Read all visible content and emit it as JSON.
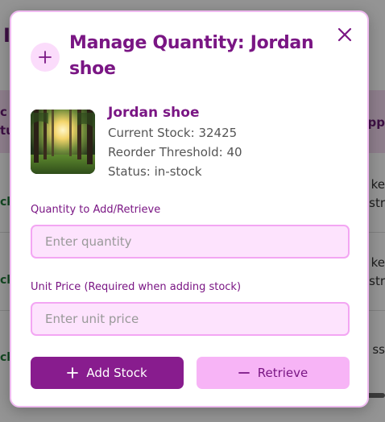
{
  "modal": {
    "title": "Manage Quantity: Jordan shoe",
    "product": {
      "name": "Jordan shoe",
      "current_stock": "Current Stock: 32425",
      "reorder_threshold": "Reorder Threshold: 40",
      "status": "Status: in-stock"
    },
    "quantity_field": {
      "label": "Quantity to Add/Retrieve",
      "placeholder": "Enter quantity",
      "value": ""
    },
    "price_field": {
      "label": "Unit Price (Required when adding stock)",
      "placeholder": "Enter unit price",
      "value": ""
    },
    "add_button_label": "Add Stock",
    "retrieve_button_label": "Retrieve"
  },
  "background": {
    "title_fragment": "I",
    "left_header": [
      "c",
      "tu"
    ],
    "right_header": "upp",
    "rows": [
      {
        "left": "ck",
        "right": [
          "ke",
          "str"
        ]
      },
      {
        "left": "ck",
        "right": [
          "ke",
          "str"
        ]
      },
      {
        "left": "ck",
        "right": [
          "ss"
        ]
      }
    ]
  },
  "colors": {
    "accent": "#7a1684",
    "button_primary": "#881c8e",
    "button_secondary": "#f7b4f6",
    "input_bg": "#fde3fd",
    "input_border": "#f3a6f3"
  },
  "icons": {
    "close": "close-icon",
    "header": "plus-icon",
    "add": "plus-icon",
    "retrieve": "minus-icon"
  }
}
